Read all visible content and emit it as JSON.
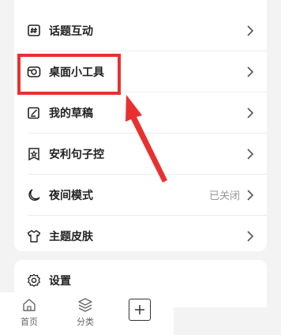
{
  "menu": {
    "items": [
      {
        "label": "话题互动",
        "icon": "hashtag-chat-icon"
      },
      {
        "label": "桌面小工具",
        "icon": "widget-icon"
      },
      {
        "label": "我的草稿",
        "icon": "draft-edit-icon"
      },
      {
        "label": "安利句子控",
        "icon": "star-bookmark-icon"
      },
      {
        "label": "夜间模式",
        "icon": "moon-icon",
        "value": "已关闭"
      },
      {
        "label": "主题皮肤",
        "icon": "tshirt-icon"
      }
    ]
  },
  "settings": {
    "label": "设置",
    "icon": "gear-icon"
  },
  "bottom_nav": {
    "tabs": [
      {
        "label": "首页",
        "icon": "home-icon"
      },
      {
        "label": "分类",
        "icon": "layers-icon"
      }
    ],
    "add_icon": "plus-icon"
  },
  "colors": {
    "highlight": "#e8312f",
    "arrow": "#e8312f"
  }
}
